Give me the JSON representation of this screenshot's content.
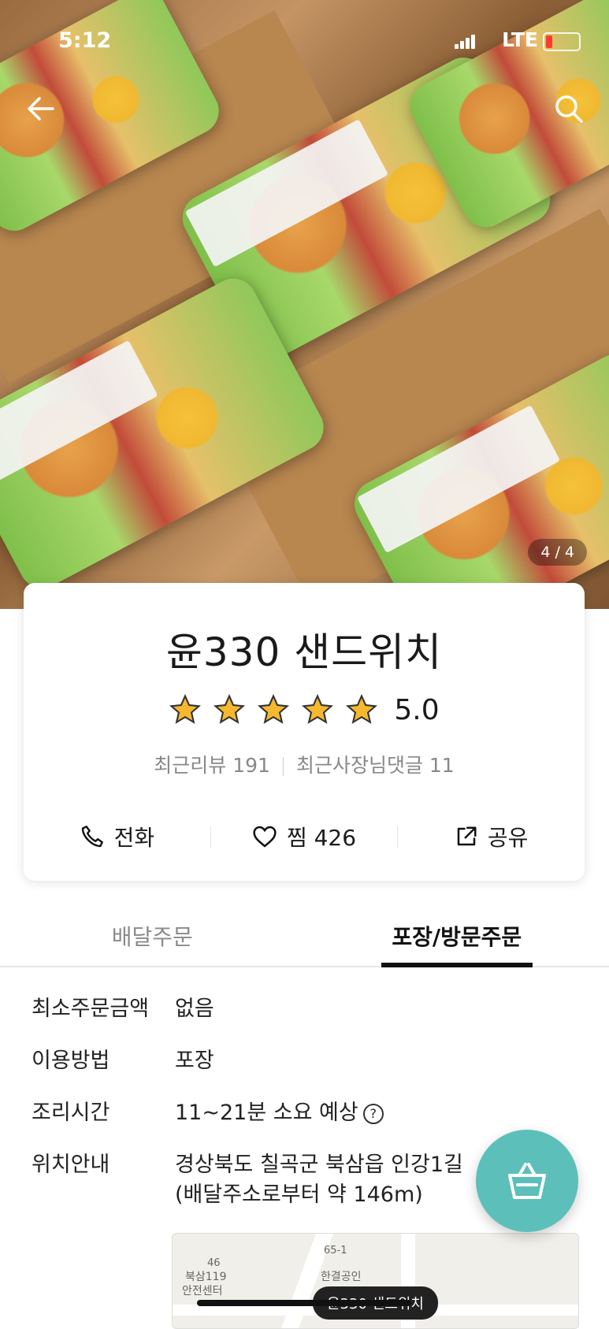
{
  "status_bar": {
    "time": "5:12",
    "network": "LTE"
  },
  "gallery": {
    "counter": "4 / 4"
  },
  "store": {
    "name": "윤330 샌드위치",
    "rating": "5.0",
    "stars": 5,
    "reviews": "최근리뷰 191",
    "owner_comments": "최근사장님댓글 11"
  },
  "actions": {
    "call": "전화",
    "like": "찜 426",
    "share": "공유"
  },
  "tabs": [
    {
      "label": "배달주문",
      "active": false
    },
    {
      "label": "포장/방문주문",
      "active": true
    }
  ],
  "info": {
    "min_order_label": "최소주문금액",
    "min_order_value": "없음",
    "method_label": "이용방법",
    "method_value": "포장",
    "cook_label": "조리시간",
    "cook_value": "11~21분 소요 예상",
    "location_label": "위치안내",
    "location_value": "경상북도 칠곡군 북삼읍 인강1길",
    "location_distance": "(배달주소로부터 약 146m)"
  },
  "map": {
    "pin_label": "윤330 샌드위치",
    "poi_1": "북삼119",
    "poi_1b": "안전센터",
    "poi_2": "한결공인",
    "num_1": "46",
    "num_2": "65-1"
  },
  "colors": {
    "accent": "#5dbfb9",
    "star": "#f5b82e"
  }
}
